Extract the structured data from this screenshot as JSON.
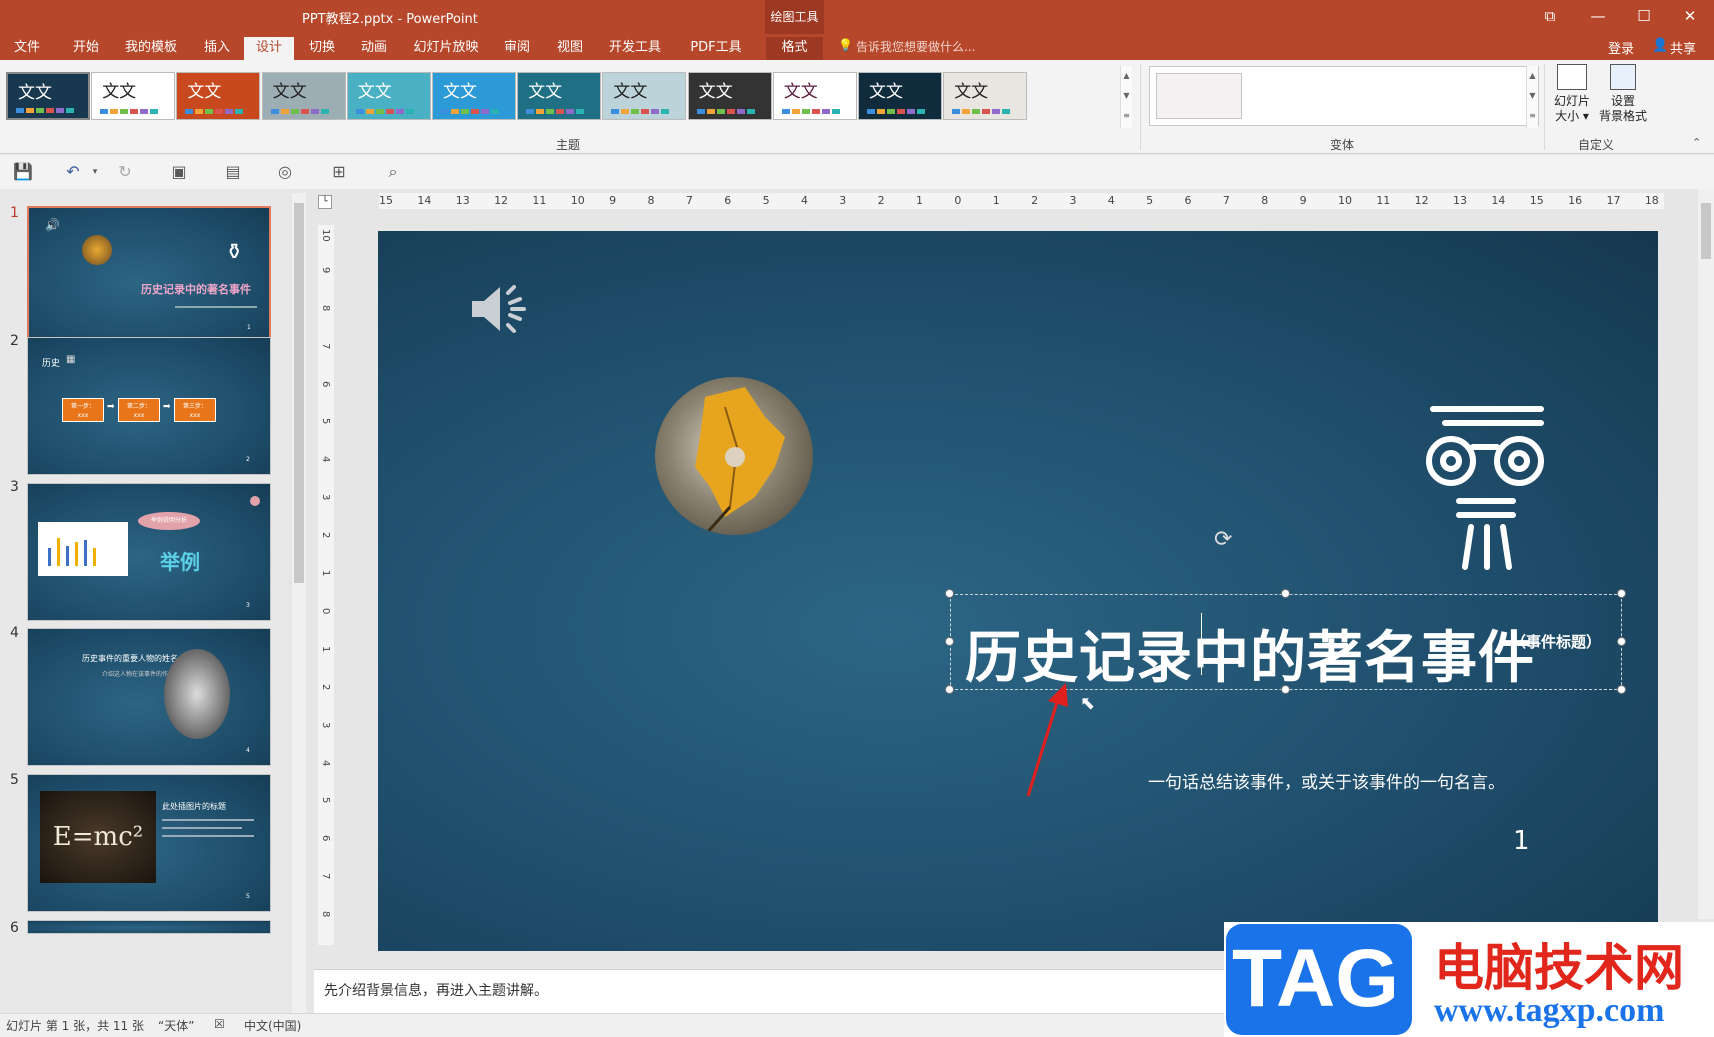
{
  "window": {
    "title": "PPT教程2.pptx - PowerPoint",
    "drawing_tools": "绘图工具",
    "buttons": {
      "restore": "⧉",
      "minimize": "—",
      "maximize": "☐",
      "close": "✕"
    }
  },
  "tabs": [
    {
      "label": "文件"
    },
    {
      "label": "开始"
    },
    {
      "label": "我的模板"
    },
    {
      "label": "插入"
    },
    {
      "label": "设计",
      "active": true
    },
    {
      "label": "切换"
    },
    {
      "label": "动画"
    },
    {
      "label": "幻灯片放映"
    },
    {
      "label": "审阅"
    },
    {
      "label": "视图"
    },
    {
      "label": "开发工具"
    },
    {
      "label": "PDF工具集"
    },
    {
      "label": "格式"
    }
  ],
  "tell_me": "告诉我您想要做什么...",
  "account": {
    "login": "登录",
    "share": "共享"
  },
  "ribbon": {
    "themes": [
      {
        "text": "文文",
        "bg": "#17384f",
        "fg": "#ffffff"
      },
      {
        "text": "文文",
        "bg": "#ffffff",
        "fg": "#222222"
      },
      {
        "text": "文文",
        "bg": "#c8491e",
        "fg": "#ffffff"
      },
      {
        "text": "文文",
        "bg": "#9cadb3",
        "fg": "#222222"
      },
      {
        "text": "文文",
        "bg": "#4ab0c3",
        "fg": "#ffffff"
      },
      {
        "text": "文文",
        "bg": "#2c9ad6",
        "fg": "#ffffff"
      },
      {
        "text": "文文",
        "bg": "#1f6f85",
        "fg": "#ffffff"
      },
      {
        "text": "文文",
        "bg": "#bcd3d9",
        "fg": "#222222"
      },
      {
        "text": "文文",
        "bg": "#333333",
        "fg": "#ffffff"
      },
      {
        "text": "文文",
        "bg": "#ffffff",
        "fg": "#5a1a3a"
      },
      {
        "text": "文文",
        "bg": "#0f2b3c",
        "fg": "#ffffff"
      },
      {
        "text": "文文",
        "bg": "#e9e6e2",
        "fg": "#222222"
      }
    ],
    "group_theme": "主题",
    "group_variant": "变体",
    "group_custom": "自定义",
    "slide_size_label": "幻灯片\n大小 ▾",
    "bg_format_label": "设置\n背景格式"
  },
  "qat_icons": [
    "save-icon",
    "undo-icon",
    "redo-icon",
    "from-beginning-icon",
    "new-slide-icon",
    "record-icon",
    "present-icon",
    "preview-icon"
  ],
  "thumbnails": [
    {
      "num": "1",
      "title": "历史记录中的著名事件",
      "page": "1"
    },
    {
      "num": "2",
      "title": "历史",
      "steps": [
        "第一步：\nxxx",
        "第二步：\nxxx",
        "第三步：\nxxx"
      ],
      "page": "2"
    },
    {
      "num": "3",
      "title": "举例",
      "bubble": "举例说明分析",
      "page": "3"
    },
    {
      "num": "4",
      "title": "历史事件的重要人物的姓名",
      "sub": "介绍这人物在该事件的作用",
      "page": "4"
    },
    {
      "num": "5",
      "title": "此处插图片的标题",
      "formula": "E=mc²",
      "page": "5"
    },
    {
      "num": "6"
    }
  ],
  "slide": {
    "title": "历史记录中的著名事件",
    "title_note": "（事件标题）",
    "subtitle": "一句话总结该事件，或关于该事件的一句名言。",
    "page_num": "1"
  },
  "ruler": {
    "h": [
      "15",
      "14",
      "13",
      "12",
      "11",
      "10",
      "9",
      "8",
      "7",
      "6",
      "5",
      "4",
      "3",
      "2",
      "1",
      "0",
      "1",
      "2",
      "3",
      "4",
      "5",
      "6",
      "7",
      "8",
      "9",
      "10",
      "11",
      "12",
      "13",
      "14",
      "15",
      "16",
      "17",
      "18"
    ],
    "v": [
      "10",
      "9",
      "8",
      "7",
      "6",
      "5",
      "4",
      "3",
      "2",
      "1",
      "0",
      "1",
      "2",
      "3",
      "4",
      "5",
      "6",
      "7",
      "8"
    ]
  },
  "notes": "先介绍背景信息，再进入主题讲解。",
  "status": {
    "slide": "幻灯片 第 1 张，共 11 张",
    "theme": "“天体”",
    "lang": "中文(中国)"
  },
  "watermark": {
    "tag": "TAG",
    "cn": "电脑技术网",
    "url": "www.tagxp.com"
  }
}
